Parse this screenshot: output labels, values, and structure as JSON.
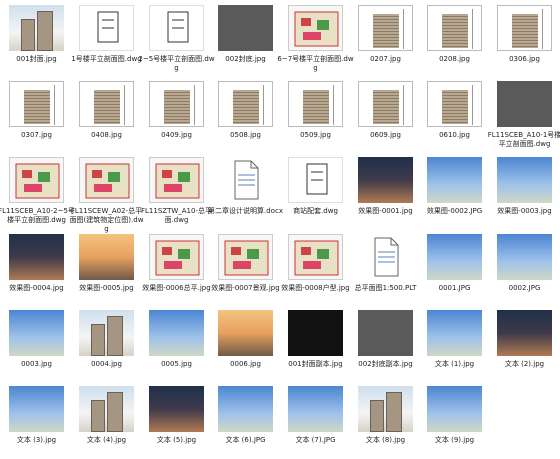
{
  "files": [
    {
      "caption": "001封面.jpg",
      "kind": "photo"
    },
    {
      "caption": "1号楼平立剖面图.dwg",
      "kind": "cad"
    },
    {
      "caption": "2~5号楼平立剖面图.dwg",
      "kind": "cad"
    },
    {
      "caption": "002封底.jpg",
      "kind": "grey"
    },
    {
      "caption": "6~7号楼平立剖面图.dwg",
      "kind": "plan"
    },
    {
      "caption": "0207.jpg",
      "kind": "sheet"
    },
    {
      "caption": "0208.jpg",
      "kind": "sheet"
    },
    {
      "caption": "0306.jpg",
      "kind": "sheet"
    },
    {
      "caption": "0307.jpg",
      "kind": "sheet"
    },
    {
      "caption": "0408.jpg",
      "kind": "sheet"
    },
    {
      "caption": "0409.jpg",
      "kind": "sheet"
    },
    {
      "caption": "0508.jpg",
      "kind": "sheet"
    },
    {
      "caption": "0509.jpg",
      "kind": "sheet"
    },
    {
      "caption": "0609.jpg",
      "kind": "sheet"
    },
    {
      "caption": "0610.jpg",
      "kind": "sheet"
    },
    {
      "caption": "FL11SCEB_A10-1号楼平立剖面图.dwg",
      "kind": "grey"
    },
    {
      "caption": "FL11SCEB_A10-2~5号楼平立剖面图.dwg",
      "kind": "plan"
    },
    {
      "caption": "FL11SCEW_A02-总平面图(建筑物定位图).dwg",
      "kind": "plan"
    },
    {
      "caption": "FL11SZTW_A10-总平面.dwg",
      "kind": "plan"
    },
    {
      "caption": "第二章设计说明算.docx",
      "kind": "file"
    },
    {
      "caption": "商站配套.dwg",
      "kind": "cad"
    },
    {
      "caption": "效果图-0001.jpg",
      "kind": "dusk"
    },
    {
      "caption": "效果图-0002.JPG",
      "kind": "sky"
    },
    {
      "caption": "效果图-0003.jpg",
      "kind": "sky"
    },
    {
      "caption": "效果图-0004.jpg",
      "kind": "dusk"
    },
    {
      "caption": "效果图-0005.jpg",
      "kind": "warm"
    },
    {
      "caption": "效果图-0006总平.jpg",
      "kind": "plan"
    },
    {
      "caption": "效果图-0007景观.jpg",
      "kind": "plan"
    },
    {
      "caption": "效果图-0008户型.jpg",
      "kind": "plan"
    },
    {
      "caption": "总平面图1:500.PLT",
      "kind": "file"
    },
    {
      "caption": "0001.JPG",
      "kind": "sky"
    },
    {
      "caption": "0002.JPG",
      "kind": "sky"
    },
    {
      "caption": "0003.jpg",
      "kind": "sky"
    },
    {
      "caption": "0004.jpg",
      "kind": "photo"
    },
    {
      "caption": "0005.jpg",
      "kind": "sky"
    },
    {
      "caption": "0006.jpg",
      "kind": "warm"
    },
    {
      "caption": "001封面副本.jpg",
      "kind": "dark"
    },
    {
      "caption": "002封底副本.jpg",
      "kind": "grey"
    },
    {
      "caption": "文本 (1).jpg",
      "kind": "sky"
    },
    {
      "caption": "文本 (2).jpg",
      "kind": "dusk"
    },
    {
      "caption": "文本 (3).jpg",
      "kind": "sky"
    },
    {
      "caption": "文本 (4).jpg",
      "kind": "photo"
    },
    {
      "caption": "文本 (5).jpg",
      "kind": "dusk"
    },
    {
      "caption": "文本 (6).JPG",
      "kind": "sky"
    },
    {
      "caption": "文本 (7).JPG",
      "kind": "sky"
    },
    {
      "caption": "文本 (8).jpg",
      "kind": "photo"
    },
    {
      "caption": "文本 (9).jpg",
      "kind": "sky"
    },
    {
      "caption": "",
      "kind": "none"
    }
  ],
  "watermark": "wm"
}
